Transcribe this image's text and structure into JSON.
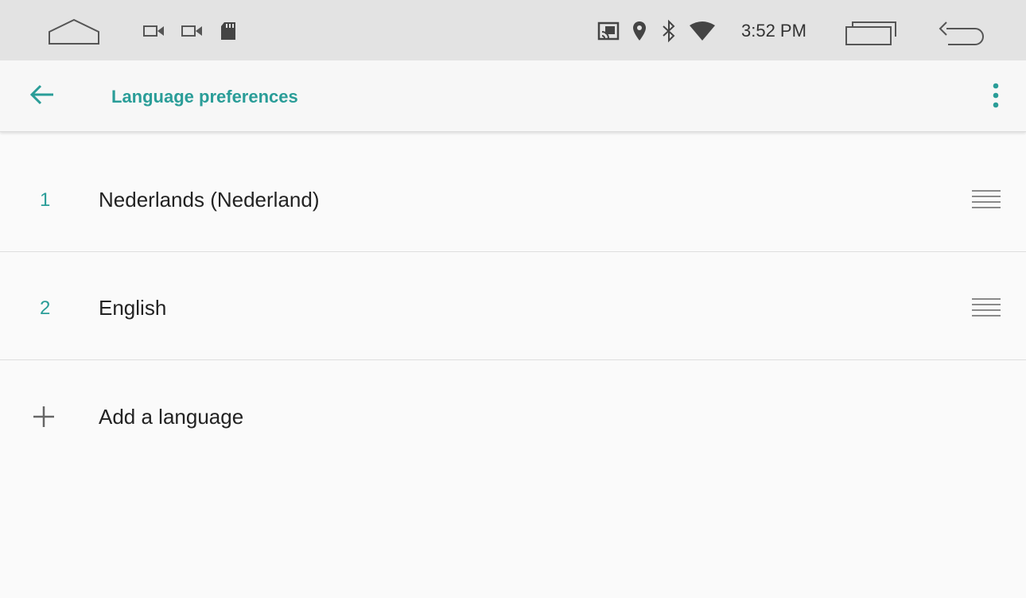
{
  "status_bar": {
    "time": "3:52 PM",
    "icons": [
      "home-nav-icon",
      "video-camera-icon",
      "video-camera-icon",
      "sd-card-icon",
      "cast-icon",
      "location-icon",
      "bluetooth-icon",
      "wifi-icon",
      "recent-apps-nav-icon",
      "back-nav-icon"
    ]
  },
  "app_bar": {
    "title": "Language preferences",
    "back_icon": "arrow-left-icon",
    "overflow_icon": "more-vert-icon"
  },
  "languages": [
    {
      "index": "1",
      "name": "Nederlands (Nederland)"
    },
    {
      "index": "2",
      "name": "English"
    }
  ],
  "add_language": {
    "label": "Add a language",
    "icon": "plus-icon"
  },
  "colors": {
    "accent": "#2a9d98",
    "status_bar_bg": "#e3e3e3",
    "background": "#fafafa"
  }
}
